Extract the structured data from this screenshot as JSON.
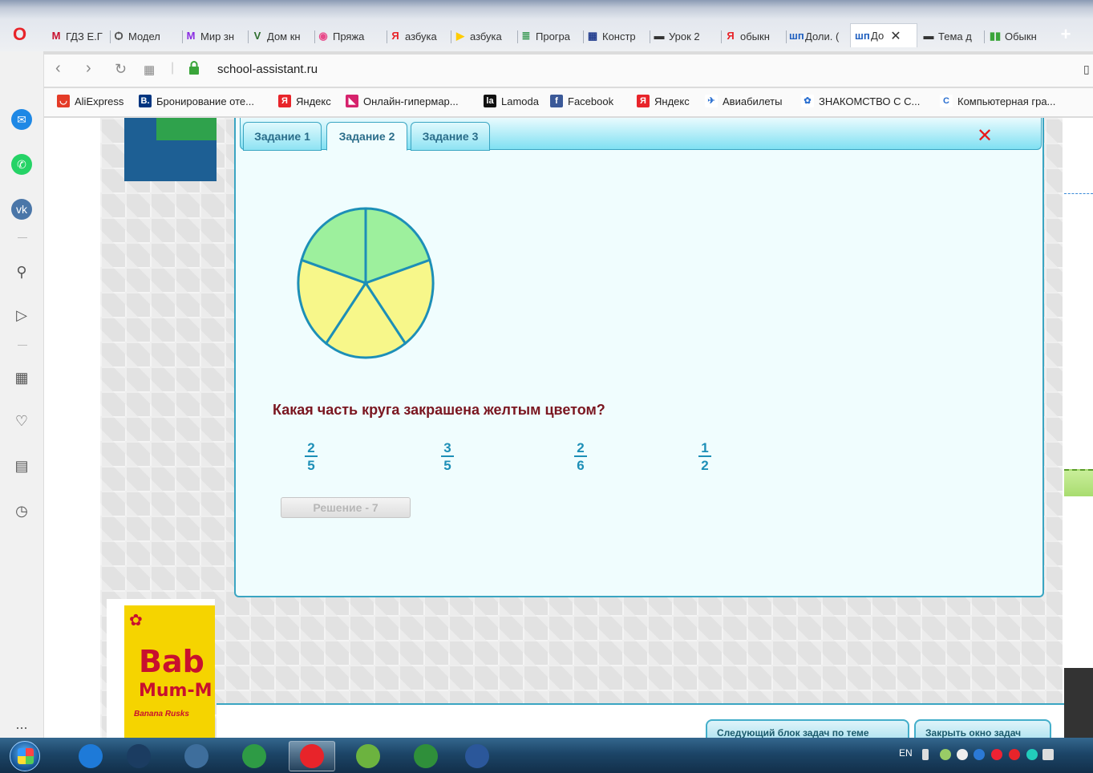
{
  "browser": {
    "tabs": [
      {
        "label": "ГДЗ Е.Г",
        "icon": "М",
        "color": "#c8102e"
      },
      {
        "label": "Модел",
        "icon": "Ѻ",
        "color": "#555555"
      },
      {
        "label": "Мир зн",
        "icon": "M",
        "color": "#8a2be2"
      },
      {
        "label": "Дом кн",
        "icon": "V",
        "color": "#2f6f2f"
      },
      {
        "label": "Пряжа",
        "icon": "◉",
        "color": "#e84a8a"
      },
      {
        "label": "азбука",
        "icon": "Я",
        "color": "#e8242a"
      },
      {
        "label": "азбука",
        "icon": "▶",
        "color": "#ffcc00"
      },
      {
        "label": "Програ",
        "icon": "≣",
        "color": "#1e8c3a"
      },
      {
        "label": "Констр",
        "icon": "▦",
        "color": "#1f3a8c"
      },
      {
        "label": "Урок 2",
        "icon": "▬",
        "color": "#333333"
      },
      {
        "label": "обыкн",
        "icon": "Я",
        "color": "#e8242a"
      },
      {
        "label": "Доли. (",
        "icon": "шп",
        "color": "#1f5fbf"
      },
      {
        "label": "До",
        "icon": "шп",
        "color": "#1f5fbf",
        "active": true
      },
      {
        "label": "Тема д",
        "icon": "▬",
        "color": "#333333"
      },
      {
        "label": "Обыкн",
        "icon": "▮▮",
        "color": "#3aa53a"
      }
    ],
    "active_tab_close": "✕",
    "new_tab": "+",
    "url": "school-assistant.ru",
    "bookmarks": [
      {
        "label": "AliExpress",
        "icon": "◡",
        "color": "#e43b27"
      },
      {
        "label": "Бронирование оте...",
        "icon": "B.",
        "color": "#003580"
      },
      {
        "label": "Яндекс",
        "icon": "Я",
        "color": "#e8242a"
      },
      {
        "label": "Онлайн-гипермар...",
        "icon": "◣",
        "color": "#d6226c"
      },
      {
        "label": "Lamoda",
        "icon": "la",
        "color": "#111111"
      },
      {
        "label": "Facebook",
        "icon": "f",
        "color": "#3b5998"
      },
      {
        "label": "Яндекс",
        "icon": "Я",
        "color": "#e8242a"
      },
      {
        "label": "Авиабилеты",
        "icon": "✈",
        "color": "#ffffff"
      },
      {
        "label": "ЗНАКОМСТВО С С...",
        "icon": "✿",
        "color": "#ffffff"
      },
      {
        "label": "Компьютерная гра...",
        "icon": "C",
        "color": "#ffffff"
      }
    ]
  },
  "sidebar": {
    "items": [
      {
        "name": "messenger-icon",
        "glyph": "✉",
        "color": "#1e88e5"
      },
      {
        "name": "whatsapp-icon",
        "glyph": "✆",
        "color": "#25d366"
      },
      {
        "name": "vk-icon",
        "glyph": "vk",
        "color": "#4a76a8"
      },
      {
        "name": "search-icon",
        "glyph": "⚲",
        "color": ""
      },
      {
        "name": "send-icon",
        "glyph": "▷",
        "color": ""
      },
      {
        "name": "speed-dial-icon",
        "glyph": "▦",
        "color": ""
      },
      {
        "name": "heart-icon",
        "glyph": "♡",
        "color": ""
      },
      {
        "name": "news-icon",
        "glyph": "▤",
        "color": ""
      },
      {
        "name": "history-icon",
        "glyph": "◷",
        "color": ""
      }
    ],
    "more": "..."
  },
  "dialog": {
    "tabs": [
      {
        "label": "Задание 1"
      },
      {
        "label": "Задание 2",
        "active": true
      },
      {
        "label": "Задание 3"
      }
    ],
    "close": "✕",
    "pie": {
      "slices": 5,
      "yellow": 3,
      "green": 2,
      "green_color": "#9df09d",
      "yellow_color": "#f7f78a",
      "stroke_color": "#1d8fb7"
    },
    "question": "Какая часть круга закрашена желтым цветом?",
    "answers": [
      {
        "num": "2",
        "den": "5"
      },
      {
        "num": "3",
        "den": "5"
      },
      {
        "num": "2",
        "den": "6"
      },
      {
        "num": "1",
        "den": "2"
      }
    ],
    "solution_button": "Решение - 7"
  },
  "page": {
    "product": {
      "title": "Bab",
      "subtitle": "Mum-M",
      "line": "Banana Rusks"
    },
    "bottom_buttons": [
      "Следующий блок задач по теме",
      "Закрыть окно задач"
    ]
  },
  "taskbar": {
    "language": "EN",
    "apps": [
      {
        "name": "ie-icon",
        "color": "#1e7ad8"
      },
      {
        "name": "scanner-icon",
        "color": "#1b3c61"
      },
      {
        "name": "media-player-icon",
        "color": "#3e6e9c"
      },
      {
        "name": "chrome-icon",
        "color": "#2e9b45"
      },
      {
        "name": "opera-icon",
        "color": "#e8242a",
        "active": true
      },
      {
        "name": "utorrent-icon",
        "color": "#6cb33f"
      },
      {
        "name": "book-icon",
        "color": "#2f8f3a"
      },
      {
        "name": "word-icon",
        "color": "#2b579a"
      }
    ]
  }
}
